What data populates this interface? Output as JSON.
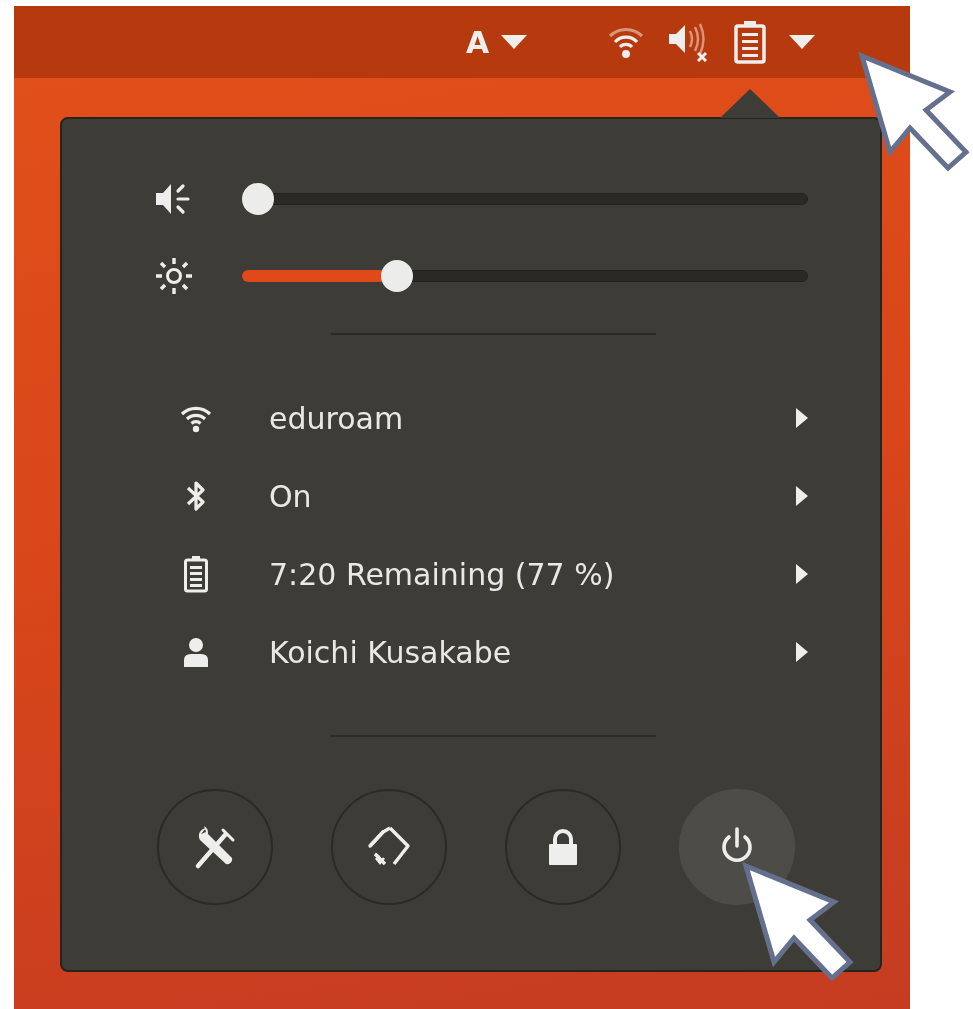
{
  "top_bar": {
    "input_method": "A",
    "sound_muted": true
  },
  "sliders": [
    {
      "kind": "volume",
      "level": 0.0
    },
    {
      "kind": "brightness",
      "level": 0.26
    }
  ],
  "menu_items": [
    {
      "kind": "wifi",
      "label": "eduroam"
    },
    {
      "kind": "bluetooth",
      "label": "On"
    },
    {
      "kind": "battery",
      "label": "7:20 Remaining (77 %)"
    },
    {
      "kind": "user",
      "label": "Koichi Kusakabe"
    }
  ],
  "buttons": [
    {
      "kind": "settings",
      "hovered": false
    },
    {
      "kind": "rotation-lock",
      "hovered": false
    },
    {
      "kind": "lock",
      "hovered": false
    },
    {
      "kind": "power",
      "hovered": true
    }
  ]
}
